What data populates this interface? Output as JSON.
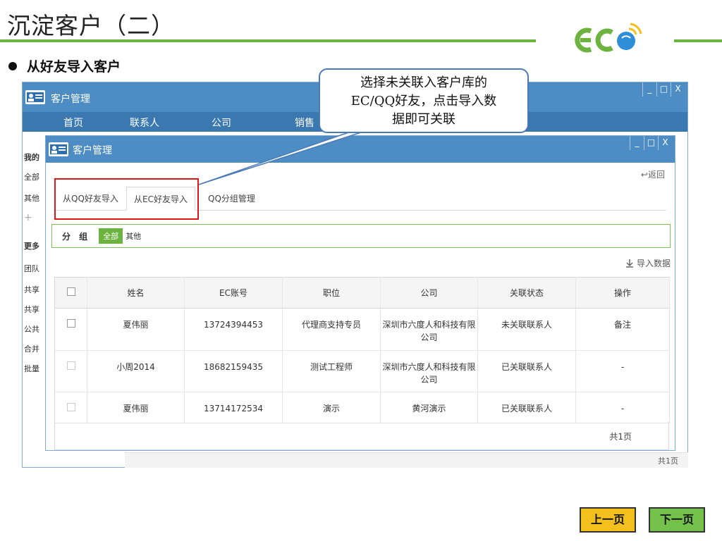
{
  "slide": {
    "title": "沉淀客户（二）",
    "bullet": "从好友导入客户",
    "callout": [
      "选择未关联入客户库的",
      "EC/QQ好友，点击导入数",
      "据即可关联"
    ],
    "nav": {
      "prev": "上一页",
      "next": "下一页"
    },
    "colors": {
      "accent": "#6cb33f",
      "window_blue": "#4d8dc4",
      "highlight_red": "#e01515"
    }
  },
  "back_window": {
    "title": "客户管理",
    "controls": [
      "_",
      "□",
      "X"
    ],
    "nav": [
      "首页",
      "联系人",
      "公司",
      "销售"
    ],
    "sidebar": [
      "我的",
      "全部",
      "其他",
      "+",
      "更多",
      "团队",
      "共享",
      "共享",
      "公共",
      "合并",
      "批量"
    ],
    "page": "共1页"
  },
  "front_window": {
    "title": "客户管理",
    "controls": [
      "_",
      "□",
      "X"
    ],
    "back_link": "返回",
    "tabs": [
      "从QQ好友导入",
      "从EC好友导入",
      "QQ分组管理"
    ],
    "group": {
      "label": "分 组",
      "all": "全部",
      "other": "其他"
    },
    "import_data": "导入数据",
    "table": {
      "headers": [
        "姓名",
        "EC账号",
        "职位",
        "公司",
        "关联状态",
        "操作"
      ],
      "rows": [
        {
          "name": "夏伟丽",
          "ec": "13724394453",
          "title": "代理商支持专员",
          "company_1": "深圳市六度人和科技有限",
          "company_2": "公司",
          "status": "未关联联系人",
          "action": "备注"
        },
        {
          "name": "小周2014",
          "ec": "18682159435",
          "title": "测试工程师",
          "company_1": "深圳市六度人和科技有限",
          "company_2": "公司",
          "status": "已关联联系人",
          "action": "-"
        },
        {
          "name": "夏伟丽",
          "ec": "13714172534",
          "title": "演示",
          "company_1": "黄河演示",
          "company_2": "",
          "status": "已关联联系人",
          "action": "-"
        }
      ],
      "total": "共1页"
    }
  }
}
